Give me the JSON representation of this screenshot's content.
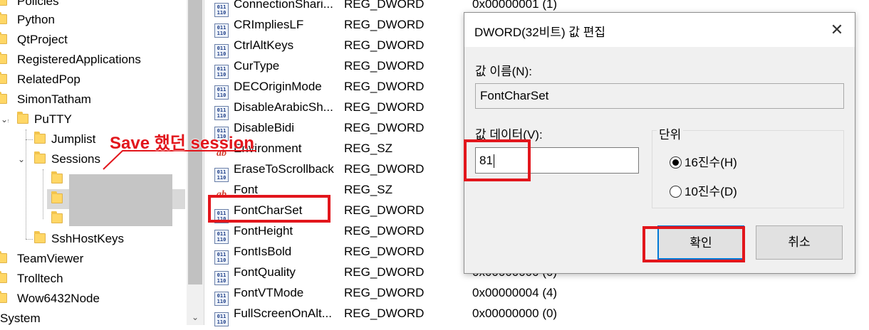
{
  "tree": {
    "items": [
      {
        "label": "Policies"
      },
      {
        "label": "Python"
      },
      {
        "label": "QtProject"
      },
      {
        "label": "RegisteredApplications"
      },
      {
        "label": "RelatedPop"
      },
      {
        "label": "SimonTatham"
      },
      {
        "label": "PuTTY"
      },
      {
        "label": "Jumplist"
      },
      {
        "label": "Sessions"
      },
      {
        "label": "SshHostKeys"
      },
      {
        "label": "TeamViewer"
      },
      {
        "label": "Trolltech"
      },
      {
        "label": "Wow6432Node"
      },
      {
        "label": "System"
      }
    ]
  },
  "values": {
    "rows": [
      {
        "name": "ConnectionShari...",
        "type": "REG_DWORD",
        "data": "0x00000001 (1)",
        "icon": "dword-icon"
      },
      {
        "name": "CRImpliesLF",
        "type": "REG_DWORD",
        "data": "",
        "icon": "dword-icon"
      },
      {
        "name": "CtrlAltKeys",
        "type": "REG_DWORD",
        "data": "",
        "icon": "dword-icon"
      },
      {
        "name": "CurType",
        "type": "REG_DWORD",
        "data": "",
        "icon": "dword-icon"
      },
      {
        "name": "DECOriginMode",
        "type": "REG_DWORD",
        "data": "",
        "icon": "dword-icon"
      },
      {
        "name": "DisableArabicSh...",
        "type": "REG_DWORD",
        "data": "",
        "icon": "dword-icon"
      },
      {
        "name": "DisableBidi",
        "type": "REG_DWORD",
        "data": "",
        "icon": "dword-icon"
      },
      {
        "name": "Environment",
        "type": "REG_SZ",
        "data": "",
        "icon": "string-icon"
      },
      {
        "name": "EraseToScrollback",
        "type": "REG_DWORD",
        "data": "",
        "icon": "dword-icon"
      },
      {
        "name": "Font",
        "type": "REG_SZ",
        "data": "",
        "icon": "string-icon"
      },
      {
        "name": "FontCharSet",
        "type": "REG_DWORD",
        "data": "",
        "icon": "dword-icon"
      },
      {
        "name": "FontHeight",
        "type": "REG_DWORD",
        "data": "",
        "icon": "dword-icon"
      },
      {
        "name": "FontIsBold",
        "type": "REG_DWORD",
        "data": "",
        "icon": "dword-icon"
      },
      {
        "name": "FontQuality",
        "type": "REG_DWORD",
        "data": "0x00000000 (0)",
        "icon": "dword-icon"
      },
      {
        "name": "FontVTMode",
        "type": "REG_DWORD",
        "data": "0x00000004 (4)",
        "icon": "dword-icon"
      },
      {
        "name": "FullScreenOnAlt...",
        "type": "REG_DWORD",
        "data": "0x00000000 (0)",
        "icon": "dword-icon"
      }
    ]
  },
  "annotation": {
    "text": "Save 했던 session",
    "color": "#e2161c"
  },
  "dialog": {
    "title": "DWORD(32비트) 값 편집",
    "close_glyph": "✕",
    "name_label": "값 이름(N):",
    "name_value": "FontCharSet",
    "data_label": "값 데이터(V):",
    "data_value": "81",
    "base_label": "단위",
    "base_hex": "16진수(H)",
    "base_dec": "10진수(D)",
    "base_selected": "hex",
    "ok_label": "확인",
    "cancel_label": "취소"
  },
  "colors": {
    "accent": "#0078d7",
    "annotation_red": "#e2161c",
    "folder": "#ffd766"
  }
}
